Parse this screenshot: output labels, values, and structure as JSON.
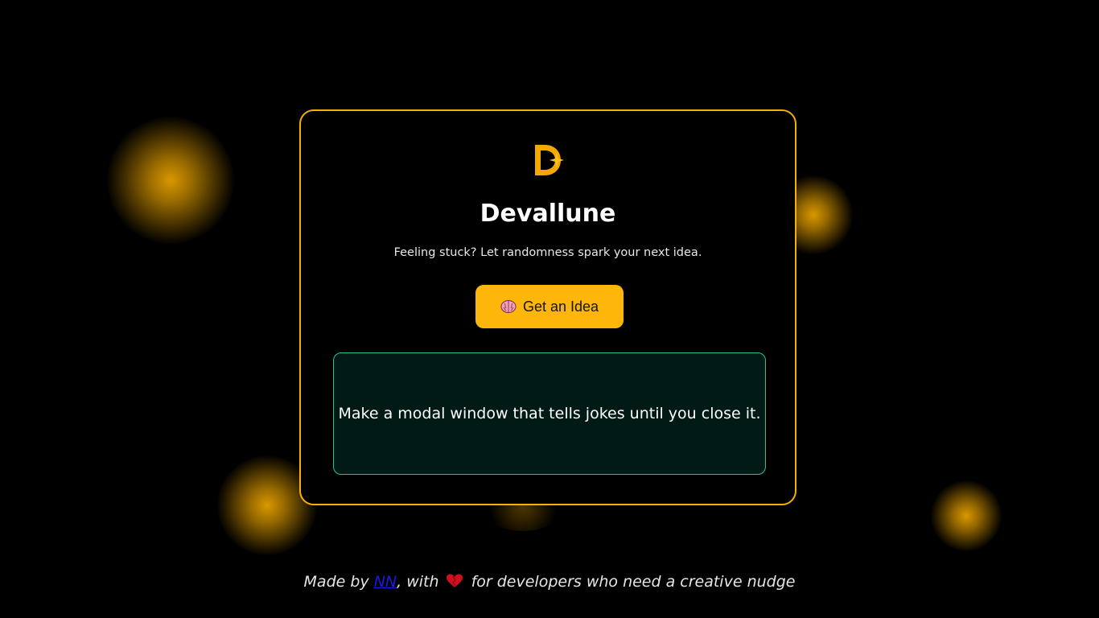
{
  "app": {
    "brand": "Devallune",
    "tagline": "Feeling stuck? Let randomness spark your next idea.",
    "logo_icon": "d-star-logo-icon",
    "accent_color": "#ffb60a"
  },
  "action": {
    "button_label": "Get an Idea",
    "button_icon": "brain-icon"
  },
  "idea": {
    "text": "Make a modal window that tells jokes until you close it."
  },
  "footer": {
    "prefix": "Made by ",
    "author_link": "NN",
    "middle": ", with",
    "heart_icon": "heart-icon",
    "suffix": " for developers who need a creative nudge"
  }
}
